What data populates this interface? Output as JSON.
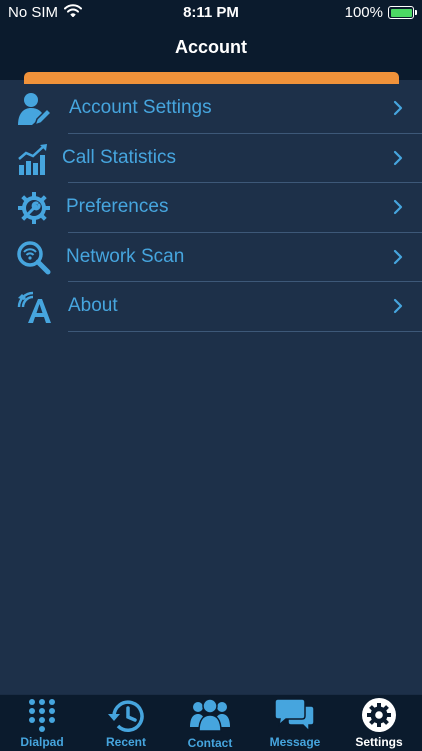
{
  "status_bar": {
    "carrier": "No SIM",
    "time": "8:11 PM",
    "battery": "100%"
  },
  "header": {
    "title": "Account"
  },
  "colors": {
    "accent": "#f0923a",
    "text_blue": "#46a5de",
    "background": "#1d3049",
    "bar": "#0b1b2d"
  },
  "menu": {
    "items": [
      {
        "label": "Account Settings",
        "icon": "user-edit-icon"
      },
      {
        "label": "Call Statistics",
        "icon": "statistics-chart-icon"
      },
      {
        "label": "Preferences",
        "icon": "gear-wrench-icon"
      },
      {
        "label": "Network Scan",
        "icon": "wifi-search-icon"
      },
      {
        "label": "About",
        "icon": "about-a-icon"
      }
    ]
  },
  "tab_bar": {
    "active": "Settings",
    "tabs": [
      {
        "label": "Dialpad",
        "icon": "dialpad-icon"
      },
      {
        "label": "Recent",
        "icon": "history-clock-icon"
      },
      {
        "label": "Contact",
        "icon": "contacts-group-icon"
      },
      {
        "label": "Message",
        "icon": "message-bubbles-icon"
      },
      {
        "label": "Settings",
        "icon": "settings-gear-icon"
      }
    ]
  }
}
